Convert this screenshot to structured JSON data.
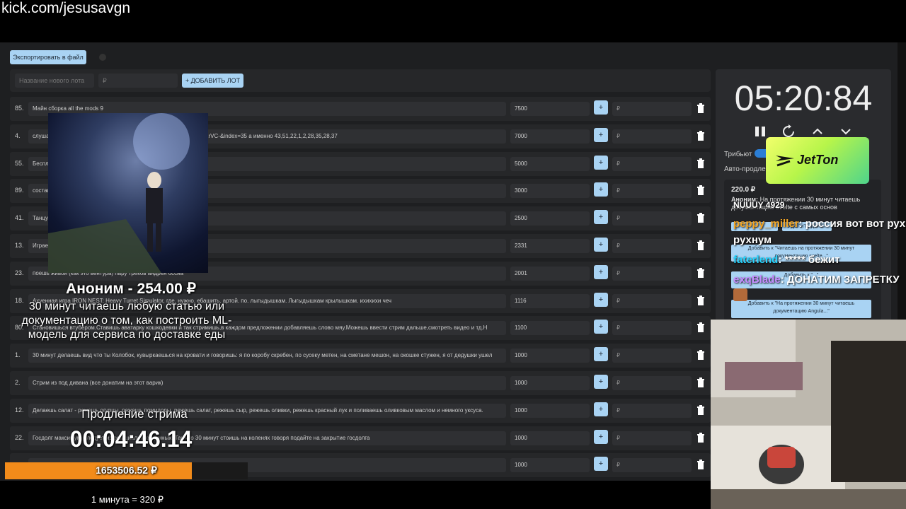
{
  "browser": {
    "url": "kick.com/jesusavgn"
  },
  "toolbar": {
    "export_label": "Экспортировать в файл"
  },
  "add_lot": {
    "name_placeholder": "Название нового лота",
    "price_placeholder": "₽",
    "add_label": "+ ДОБАВИТЬ ЛОТ"
  },
  "lots": [
    {
      "num": "85.",
      "name": "Майн сборка all the mods 9",
      "price": "7500",
      "add": "₽"
    },
    {
      "num": "4.",
      "name": "слушае                                                        =kcw4VPDG9Lw&list=PL2oDcoHo5WQ0YlkDvypIkKRTisN4KrVC-&index=35 а именно 43,51,22,1,2,28,35,28,37",
      "price": "7000",
      "add": "₽"
    },
    {
      "num": "55.",
      "name": "Беспл",
      "price": "5000",
      "add": "₽"
    },
    {
      "num": "89.",
      "name": "состав                                                            шь вилки",
      "price": "3000",
      "add": "₽"
    },
    {
      "num": "41.",
      "name": "Танцу                                                             шки крылышки / какашки мне в кармашки",
      "price": "2500",
      "add": "₽"
    },
    {
      "num": "13.",
      "name": "Играе",
      "price": "2331",
      "add": "₽"
    },
    {
      "num": "23.",
      "name": "поешь живой (как это вентура) пару треков андрея оссиа",
      "price": "2001",
      "add": "₽"
    },
    {
      "num": "18.",
      "name": "Ахуенная игра IRON NEST: Heavy Turret Simulator, где. нужно. ебашить. артой. по. лыгыдышкам. Лыгыдышкам крылышкам. ихихихи чеч",
      "price": "1116",
      "add": "₽"
    },
    {
      "num": "80.",
      "name": "Становишься втубером.Ставишь аватарку кошкодевки и так стримишь,в каждом предложении добавляешь слово мяу.Можешь ввести стрим дальше,смотреть видео и тд.Н",
      "price": "1100",
      "add": "₽"
    },
    {
      "num": "1.",
      "name": "30 минут делаешь вид что ты Колобок, кувыркаешься на кровати и говоришь: я по коробу скребен, по сусеку метен, на сметане мешон, на окошке стужен, я от дедушки ушел",
      "price": "1000",
      "add": "₽"
    },
    {
      "num": "2.",
      "name": "Стрим из под дивана (все донатим на этот варик)",
      "price": "1000",
      "add": "₽"
    },
    {
      "num": "12.",
      "name": "Делаешь салат - режешь огурцы, режешь помидоры, режешь салат, режешь сыр, режешь оливки, режешь красный лук и поливаешь оливковым маслом и немного уксуса.",
      "price": "1000",
      "add": "₽"
    },
    {
      "num": "22.",
      "name": "Госдолг                                  максимум, следует из официальных данных. Так что 30 минут стоишь на коленях говоря подайте на закрытие госдолга",
      "price": "1000",
      "add": "₽"
    },
    {
      "num": "",
      "name": "                                                                    Q",
      "price": "1000",
      "add": "₽"
    }
  ],
  "panel": {
    "timer": "05:20:84",
    "tribute_label": "Трибьют",
    "auto_label": "Авто-продле",
    "donation_amount": "220.0 ₽",
    "donation_author": "Аноним:",
    "donation_text": "На протяжении 30 минут читаешь документацию svelte с самых основ",
    "pill1": "...",
    "pill2": "Удалить донат",
    "pill3": "Добавить к \"Читаешь на протяжении 30 минут документацию svelte...\"",
    "pill4": "Добавить к \"...\"",
    "pill5": "Добавить к \"На протяжении 30 минут читаешь документацию Angula...\"",
    "covered": "NUUUY 4929"
  },
  "sponsor": {
    "logo": "JetTon"
  },
  "chat": [
    {
      "user": "peppy_miller",
      "color": "#f5a623",
      "text": ": россия вот вот рухнум"
    },
    {
      "user": "faterlend",
      "color": "#28d4ff",
      "text": ": ***** бежит"
    },
    {
      "user": "exqBlade",
      "color": "#c58cff",
      "text": ": ДОНАТИМ ЗАПРЕТКУ"
    }
  ],
  "alert": {
    "title": "Аноним - 254.00 ₽",
    "text": "30 минут читаешь любую статью или документацию о том, как построить ML-модель для сервиса по доставке еды"
  },
  "extension": {
    "label": "Продление стрима",
    "time": "00:04:46.14"
  },
  "total": {
    "amount": "1653506.52 ₽",
    "progress": 0.77
  },
  "rate": {
    "text": "1 минута = 320 ₽"
  },
  "colors": {
    "accent": "#a9d3f3",
    "orange": "#f28b1a",
    "panel": "#262729"
  }
}
